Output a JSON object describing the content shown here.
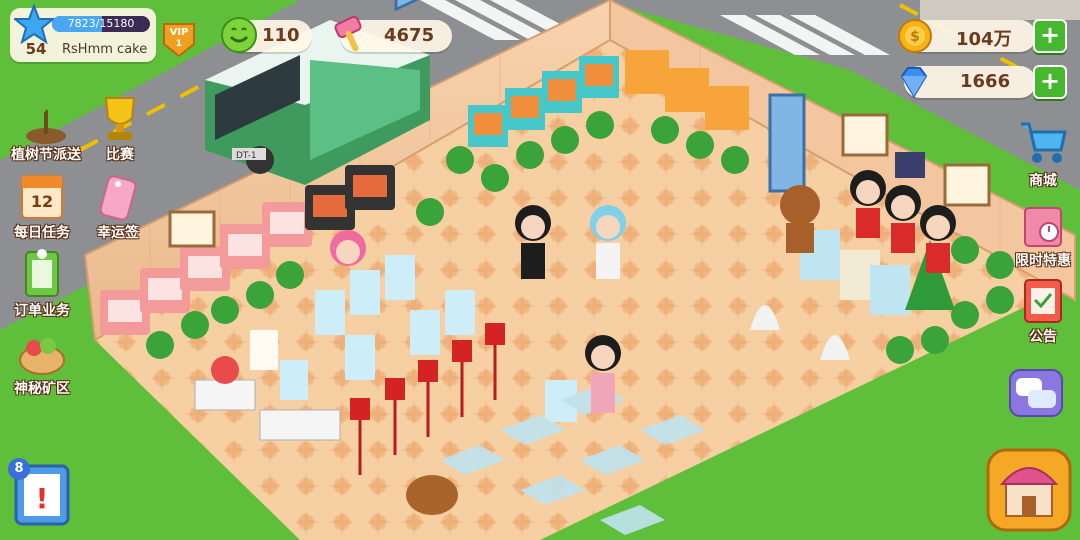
{
  "player": {
    "level": "54",
    "xp": "7823/15180",
    "xp_fraction": 0.515,
    "name": "RsHmm cake",
    "vip_label": "VIP",
    "vip_level": "1"
  },
  "resources": {
    "green_currency": "110",
    "hammer_count": "4675",
    "gold": "104万",
    "diamonds": "1666"
  },
  "left_menu": [
    {
      "label": "植树节派送",
      "icon": "tree-sapling-icon"
    },
    {
      "label": "比赛",
      "icon": "trophy-icon"
    },
    {
      "label": "每日任务",
      "icon": "calendar-icon",
      "calendar_day": "12"
    },
    {
      "label": "幸运签",
      "icon": "lucky-tag-icon"
    },
    {
      "label": "订单业务",
      "icon": "order-clipboard-icon"
    },
    {
      "label": "神秘矿区",
      "icon": "mystery-mine-icon"
    }
  ],
  "right_menu": [
    {
      "label": "商城",
      "icon": "shopping-cart-icon"
    },
    {
      "label": "限时特惠",
      "icon": "gift-bag-icon"
    },
    {
      "label": "公告",
      "icon": "announcement-icon"
    }
  ],
  "tasks_badge": "8",
  "truck_plate": "DT-1",
  "colors": {
    "grass": "#5fbf3a",
    "floor": "#f6c89a",
    "wall": "#f3c6a0",
    "accent_green": "#46b82d",
    "gold": "#f5b315",
    "diamond": "#3d8ef0"
  }
}
